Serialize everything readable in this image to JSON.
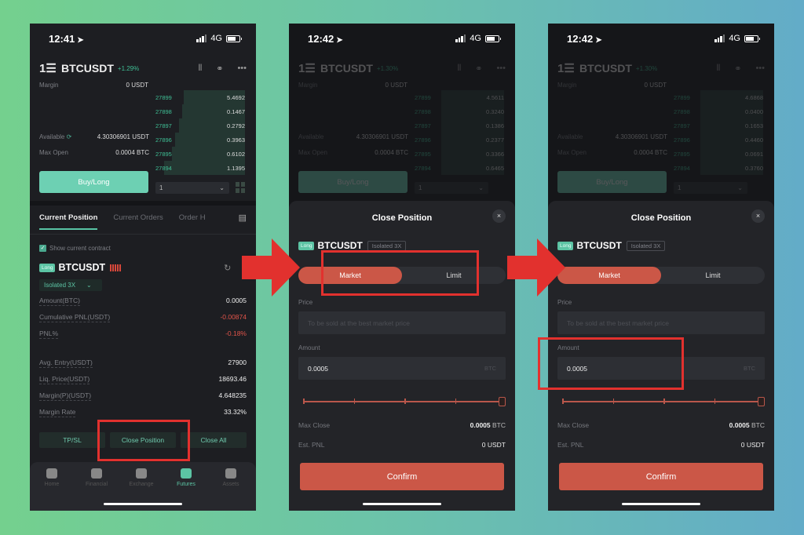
{
  "background": {
    "gradient_start": "#74d08e",
    "gradient_end": "#63acc8"
  },
  "colors": {
    "accent_green": "#5cc4a4",
    "sell_red": "#cb5747",
    "annotation_red": "#e2312e"
  },
  "screens": [
    {
      "status": {
        "time": "12:41",
        "network": "4G"
      },
      "header": {
        "menu_icon": "1☰",
        "symbol": "BTCUSDT",
        "change": "+1.29%"
      },
      "margin": {
        "label": "Margin",
        "value": "0 USDT"
      },
      "available": {
        "label": "Available",
        "value": "4.30306901 USDT"
      },
      "max_open": {
        "label": "Max Open",
        "value": "0.0004 BTC"
      },
      "orderbook": [
        {
          "price": "27899",
          "qty": "5.4692",
          "depth": 0.68
        },
        {
          "price": "27898",
          "qty": "0.1467",
          "depth": 0.7
        },
        {
          "price": "27897",
          "qty": "0.2792",
          "depth": 0.74
        },
        {
          "price": "27896",
          "qty": "0.3963",
          "depth": 0.78
        },
        {
          "price": "27895",
          "qty": "0.6102",
          "depth": 0.82
        },
        {
          "price": "27894",
          "qty": "1.1395",
          "depth": 0.9
        }
      ],
      "buy_button": "Buy/Long",
      "depth_select": "1",
      "tabs": [
        "Current Position",
        "Current Orders",
        "Order H"
      ],
      "show_current_contract": "Show current contract",
      "position": {
        "side": "Long",
        "symbol": "BTCUSDT",
        "margin_mode": "Isolated 3X",
        "fields": [
          {
            "label": "Amount(BTC)",
            "value": "0.0005",
            "tone": "normal"
          },
          {
            "label": "Cumulative PNL(USDT)",
            "value": "-0.00874",
            "tone": "red"
          },
          {
            "label": "PNL%",
            "value": "-0.18%",
            "tone": "red"
          },
          {
            "label": "Avg. Entry(USDT)",
            "value": "27900",
            "tone": "normal"
          },
          {
            "label": "Liq. Price(USDT)",
            "value": "18693.46",
            "tone": "normal"
          },
          {
            "label": "Margin(P)(USDT)",
            "value": "4.648235",
            "tone": "normal"
          },
          {
            "label": "Margin Rate",
            "value": "33.32%",
            "tone": "normal"
          }
        ]
      },
      "actions": [
        "TP/SL",
        "Close Position",
        "Close All"
      ],
      "tabbar": [
        {
          "label": "Home",
          "active": false
        },
        {
          "label": "Financial",
          "active": false
        },
        {
          "label": "Exchange",
          "active": false
        },
        {
          "label": "Futures",
          "active": true
        },
        {
          "label": "Assets",
          "active": false
        }
      ]
    },
    {
      "status": {
        "time": "12:42",
        "network": "4G"
      },
      "header": {
        "menu_icon": "1☰",
        "symbol": "BTCUSDT",
        "change": "+1.30%"
      },
      "margin": {
        "label": "Margin",
        "value": "0 USDT"
      },
      "available": {
        "label": "Available",
        "value": "4.30306901 USDT"
      },
      "max_open": {
        "label": "Max Open",
        "value": "0.0004 BTC"
      },
      "orderbook": [
        {
          "price": "27899",
          "qty": "4.5611",
          "depth": 0.7
        },
        {
          "price": "27898",
          "qty": "0.3240",
          "depth": 0.7
        },
        {
          "price": "27897",
          "qty": "0.1386",
          "depth": 0.7
        },
        {
          "price": "27896",
          "qty": "0.2377",
          "depth": 0.7
        },
        {
          "price": "27895",
          "qty": "0.3366",
          "depth": 0.7
        },
        {
          "price": "27894",
          "qty": "0.6465",
          "depth": 0.7
        }
      ],
      "buy_button": "Buy/Long",
      "depth_select": "1",
      "sheet": {
        "title": "Close Position",
        "close_icon": "×",
        "side": "Long",
        "symbol": "BTCUSDT",
        "margin_mode": "Isolated 3X",
        "order_types": [
          "Market",
          "Limit"
        ],
        "selected_order_type": "Market",
        "price_label": "Price",
        "price_placeholder": "To be sold at the best market price",
        "amount_label": "Amount",
        "amount_value": "0.0005",
        "amount_unit": "BTC",
        "slider_percent": 100,
        "max_close": {
          "label": "Max Close",
          "value": "0.0005",
          "unit": "BTC"
        },
        "est_pnl": {
          "label": "Est. PNL",
          "value": "0 USDT"
        },
        "confirm": "Confirm"
      }
    },
    {
      "status": {
        "time": "12:42",
        "network": "4G"
      },
      "header": {
        "menu_icon": "1☰",
        "symbol": "BTCUSDT",
        "change": "+1.30%"
      },
      "margin": {
        "label": "Margin",
        "value": "0 USDT"
      },
      "available": {
        "label": "Available",
        "value": "4.30306901 USDT"
      },
      "max_open": {
        "label": "Max Open",
        "value": "0.0004 BTC"
      },
      "orderbook": [
        {
          "price": "27899",
          "qty": "4.6868",
          "depth": 0.7
        },
        {
          "price": "27898",
          "qty": "0.0400",
          "depth": 0.7
        },
        {
          "price": "27897",
          "qty": "0.1653",
          "depth": 0.7
        },
        {
          "price": "27896",
          "qty": "0.4460",
          "depth": 0.7
        },
        {
          "price": "27895",
          "qty": "0.0691",
          "depth": 0.7
        },
        {
          "price": "27894",
          "qty": "0.3760",
          "depth": 0.7
        }
      ],
      "buy_button": "Buy/Long",
      "depth_select": "1",
      "sheet": {
        "title": "Close Position",
        "close_icon": "×",
        "side": "Long",
        "symbol": "BTCUSDT",
        "margin_mode": "Isolated 3X",
        "order_types": [
          "Market",
          "Limit"
        ],
        "selected_order_type": "Market",
        "price_label": "Price",
        "price_placeholder": "To be sold at the best market price",
        "amount_label": "Amount",
        "amount_value": "0.0005",
        "amount_unit": "BTC",
        "slider_percent": 100,
        "max_close": {
          "label": "Max Close",
          "value": "0.0005",
          "unit": "BTC"
        },
        "est_pnl": {
          "label": "Est. PNL",
          "value": "0 USDT"
        },
        "confirm": "Confirm"
      }
    }
  ],
  "annotations": [
    {
      "target": "Close Position button (screen 1)",
      "type": "highlight-box"
    },
    {
      "target": "Market/Limit toggle (screen 2)",
      "type": "highlight-box"
    },
    {
      "target": "Amount field (screen 3)",
      "type": "highlight-box"
    },
    {
      "type": "arrow",
      "direction": "right"
    },
    {
      "type": "arrow",
      "direction": "right"
    }
  ]
}
